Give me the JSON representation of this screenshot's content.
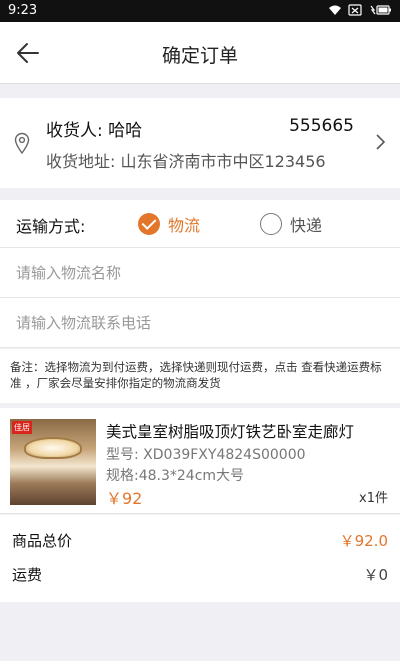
{
  "status_bar": {
    "time": "9:23",
    "icons": [
      "wifi-icon",
      "sim-icon",
      "battery-charging-icon"
    ]
  },
  "header": {
    "title": "确定订单",
    "back_icon": "arrow-left-icon"
  },
  "address": {
    "recipient_label": "收货人: 哈哈",
    "phone": "555665",
    "address_label": "收货地址: 山东省济南市市中区123456",
    "icons": [
      "location-pin-icon",
      "chevron-right-icon"
    ]
  },
  "shipping": {
    "label": "运输方式:",
    "options": [
      {
        "label": "物流",
        "selected": true
      },
      {
        "label": "快递",
        "selected": false
      }
    ]
  },
  "inputs": {
    "logistics_name": {
      "placeholder": "请输入物流名称",
      "value": ""
    },
    "logistics_phone": {
      "placeholder": "请输入物流联系电话",
      "value": ""
    }
  },
  "note": "备注：选择物流为到付运费，选择快递则现付运费，点击 查看快递运费标准 ，厂家会尽量安排你指定的物流商发货",
  "product": {
    "name": "美式皇室树脂吸顶灯铁艺卧室走廊灯",
    "model": "型号: XD039FXY4824S00000",
    "spec": "规格:48.3*24cm大号",
    "price": "￥92",
    "quantity": "x1件",
    "thumb_badge": "佳居"
  },
  "totals": {
    "goods_total_label": "商品总价",
    "goods_total_value": "￥92.0",
    "shipping_fee_label": "运费",
    "shipping_fee_value": "￥0"
  },
  "colors": {
    "accent": "#e2772b",
    "background": "#efeff4",
    "status_bar": "#111111"
  }
}
